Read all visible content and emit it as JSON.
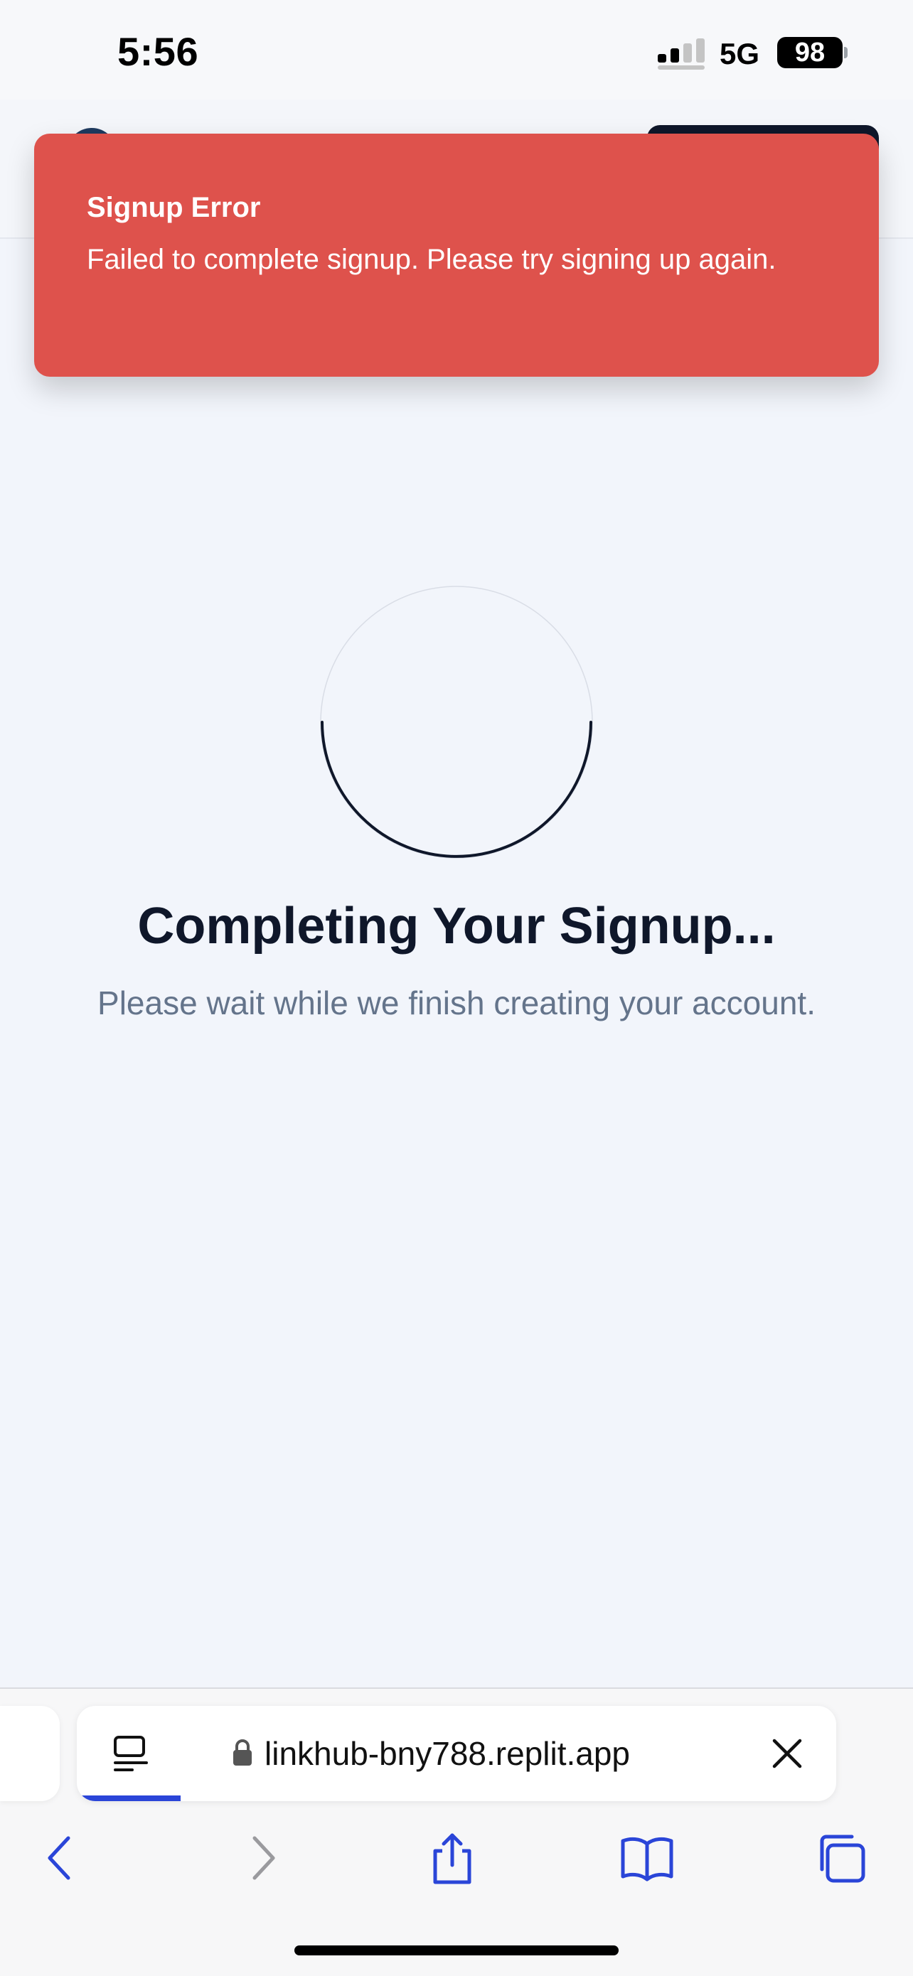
{
  "status_bar": {
    "time": "5:56",
    "network": "5G",
    "battery": "98"
  },
  "toast": {
    "title": "Signup Error",
    "message": "Failed to complete signup. Please try signing up again.",
    "color": "#de524c"
  },
  "main": {
    "title": "Completing Your Signup...",
    "subtitle": "Please wait while we finish creating your account."
  },
  "browser": {
    "url": "linkhub-bny788.replit.app",
    "accent_color": "#2a45d8",
    "toolbar": [
      "back-icon",
      "forward-icon",
      "share-icon",
      "bookmarks-icon",
      "tabs-icon"
    ]
  }
}
